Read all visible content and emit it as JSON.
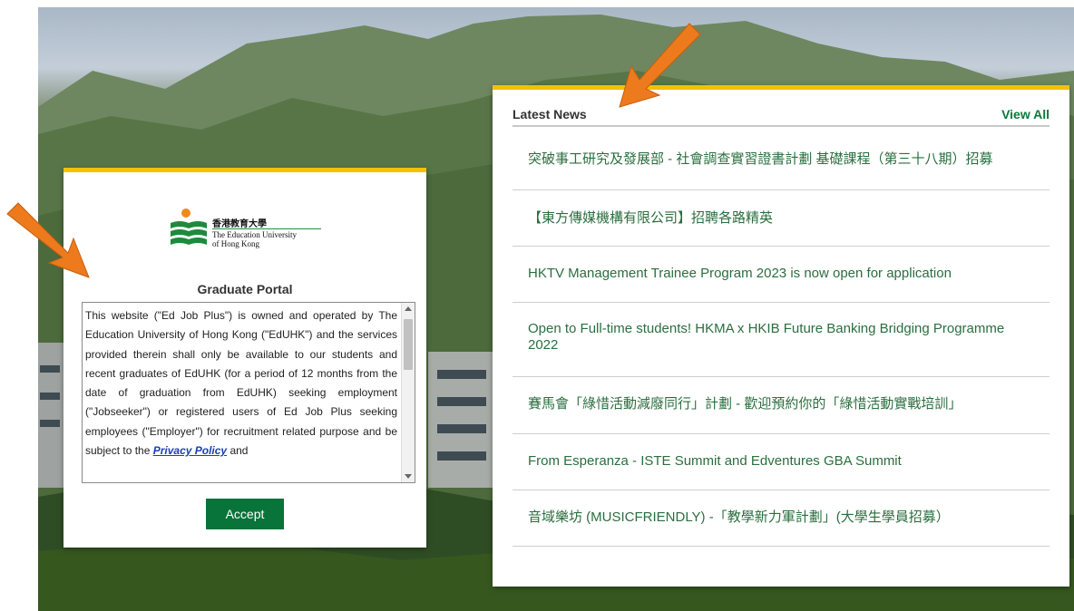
{
  "logo": {
    "name_zh": "香港教育大學",
    "name_en_line1": "The Education University",
    "name_en_line2": "of Hong Kong"
  },
  "portal": {
    "title": "Graduate Portal",
    "terms_part1": "This website (\"Ed Job Plus\") is owned and operated by The Education University of Hong Kong (\"EdUHK\") and the services provided therein shall only be available to our students and recent graduates of EdUHK (for a period of 12 months from the date of graduation from EdUHK) seeking employment (\"Jobseeker\") or registered users of Ed Job Plus seeking employees (\"Employer\") for recruitment related purpose and be subject to the ",
    "privacy_link": "Privacy Policy",
    "terms_part2": " and",
    "accept_label": "Accept"
  },
  "news": {
    "heading": "Latest News",
    "view_all": "View All",
    "items": [
      "突破事工研究及發展部 - 社會調查實習證書計劃 基礎課程（第三十八期）招募",
      "【東方傳媒機構有限公司】招聘各路精英",
      "HKTV Management Trainee Program 2023 is now open for application",
      "Open to Full-time students! HKMA x HKIB Future Banking Bridging Programme 2022",
      "賽馬會「綠惜活動減廢同行」計劃 - 歡迎預約你的「綠惜活動實戰培訓」",
      "From Esperanza - ISTE Summit and Edventures GBA Summit",
      "音域樂坊 (MUSICFRIENDLY) -「教學新力軍計劃」(大學生學員招募）"
    ]
  },
  "colors": {
    "accent_yellow": "#f2c200",
    "brand_green": "#08743a",
    "link_green": "#2b6e3f",
    "annotation_orange": "#ee7a1e"
  },
  "icons": [
    "scroll-up-arrow-icon",
    "scroll-down-arrow-icon",
    "annotation-arrow-icon"
  ]
}
